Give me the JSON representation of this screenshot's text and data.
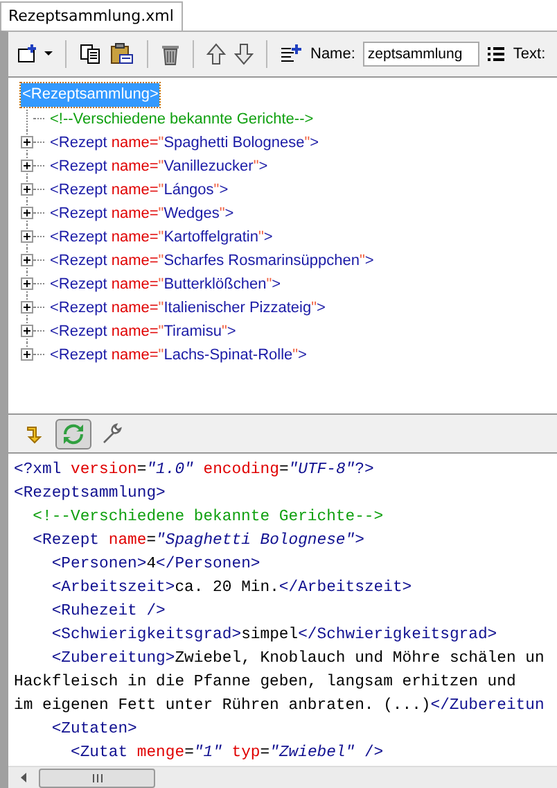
{
  "tab": {
    "label": "Rezeptsammlung.xml",
    "selected": true
  },
  "toolbar": {
    "name_label": "Name:",
    "name_value": "zeptsammlung",
    "text_label": "Text:"
  },
  "tree": {
    "root": {
      "label": "<Rezeptsammlung>",
      "selected": true,
      "children": [
        {
          "kind": "comment",
          "tokens": [
            {
              "kind": "comment",
              "text": "<!--Verschiedene bekannte Gerichte-->"
            }
          ]
        },
        {
          "kind": "element",
          "expanded": false,
          "tokens": [
            {
              "kind": "tag",
              "text": "<Rezept "
            },
            {
              "kind": "attr",
              "text": "name="
            },
            {
              "kind": "quote",
              "text": "\""
            },
            {
              "kind": "value",
              "text": "Spaghetti Bolognese"
            },
            {
              "kind": "quote",
              "text": "\""
            },
            {
              "kind": "tag",
              "text": ">"
            }
          ]
        },
        {
          "kind": "element",
          "expanded": false,
          "tokens": [
            {
              "kind": "tag",
              "text": "<Rezept "
            },
            {
              "kind": "attr",
              "text": "name="
            },
            {
              "kind": "quote",
              "text": "\""
            },
            {
              "kind": "value",
              "text": "Vanillezucker"
            },
            {
              "kind": "quote",
              "text": "\""
            },
            {
              "kind": "tag",
              "text": ">"
            }
          ]
        },
        {
          "kind": "element",
          "expanded": false,
          "tokens": [
            {
              "kind": "tag",
              "text": "<Rezept "
            },
            {
              "kind": "attr",
              "text": "name="
            },
            {
              "kind": "quote",
              "text": "\""
            },
            {
              "kind": "value",
              "text": "Lángos"
            },
            {
              "kind": "quote",
              "text": "\""
            },
            {
              "kind": "tag",
              "text": ">"
            }
          ]
        },
        {
          "kind": "element",
          "expanded": false,
          "tokens": [
            {
              "kind": "tag",
              "text": "<Rezept "
            },
            {
              "kind": "attr",
              "text": "name="
            },
            {
              "kind": "quote",
              "text": "\""
            },
            {
              "kind": "value",
              "text": "Wedges"
            },
            {
              "kind": "quote",
              "text": "\""
            },
            {
              "kind": "tag",
              "text": ">"
            }
          ]
        },
        {
          "kind": "element",
          "expanded": false,
          "tokens": [
            {
              "kind": "tag",
              "text": "<Rezept "
            },
            {
              "kind": "attr",
              "text": "name="
            },
            {
              "kind": "quote",
              "text": "\""
            },
            {
              "kind": "value",
              "text": "Kartoffelgratin"
            },
            {
              "kind": "quote",
              "text": "\""
            },
            {
              "kind": "tag",
              "text": ">"
            }
          ]
        },
        {
          "kind": "element",
          "expanded": false,
          "tokens": [
            {
              "kind": "tag",
              "text": "<Rezept "
            },
            {
              "kind": "attr",
              "text": "name="
            },
            {
              "kind": "quote",
              "text": "\""
            },
            {
              "kind": "value",
              "text": "Scharfes Rosmarinsüppchen"
            },
            {
              "kind": "quote",
              "text": "\""
            },
            {
              "kind": "tag",
              "text": ">"
            }
          ]
        },
        {
          "kind": "element",
          "expanded": false,
          "tokens": [
            {
              "kind": "tag",
              "text": "<Rezept "
            },
            {
              "kind": "attr",
              "text": "name="
            },
            {
              "kind": "quote",
              "text": "\""
            },
            {
              "kind": "value",
              "text": "Butterklößchen"
            },
            {
              "kind": "quote",
              "text": "\""
            },
            {
              "kind": "tag",
              "text": ">"
            }
          ]
        },
        {
          "kind": "element",
          "expanded": false,
          "tokens": [
            {
              "kind": "tag",
              "text": "<Rezept "
            },
            {
              "kind": "attr",
              "text": "name="
            },
            {
              "kind": "quote",
              "text": "\""
            },
            {
              "kind": "value",
              "text": "Italienischer Pizzateig"
            },
            {
              "kind": "quote",
              "text": "\""
            },
            {
              "kind": "tag",
              "text": ">"
            }
          ]
        },
        {
          "kind": "element",
          "expanded": false,
          "tokens": [
            {
              "kind": "tag",
              "text": "<Rezept "
            },
            {
              "kind": "attr",
              "text": "name="
            },
            {
              "kind": "quote",
              "text": "\""
            },
            {
              "kind": "value",
              "text": "Tiramisu"
            },
            {
              "kind": "quote",
              "text": "\""
            },
            {
              "kind": "tag",
              "text": ">"
            }
          ]
        },
        {
          "kind": "element",
          "expanded": false,
          "tokens": [
            {
              "kind": "tag",
              "text": "<Rezept "
            },
            {
              "kind": "attr",
              "text": "name="
            },
            {
              "kind": "quote",
              "text": "\""
            },
            {
              "kind": "value",
              "text": "Lachs-Spinat-Rolle"
            },
            {
              "kind": "quote",
              "text": "\""
            },
            {
              "kind": "tag",
              "text": ">"
            }
          ]
        }
      ]
    }
  },
  "view_buttons": [
    {
      "kind": "insert",
      "selected": false
    },
    {
      "kind": "sync",
      "selected": true
    },
    {
      "kind": "settings",
      "selected": false
    }
  ],
  "source": {
    "lines": [
      [
        {
          "kind": "tag",
          "text": "<?xml "
        },
        {
          "kind": "attr",
          "text": "version"
        },
        {
          "kind": "punct",
          "text": "="
        },
        {
          "kind": "value",
          "text": "\"1.0\""
        },
        {
          "kind": "attr",
          "text": " encoding"
        },
        {
          "kind": "punct",
          "text": "="
        },
        {
          "kind": "value",
          "text": "\"UTF-8\""
        },
        {
          "kind": "tag",
          "text": "?>"
        }
      ],
      [
        {
          "kind": "tag",
          "text": "<Rezeptsammlung>"
        }
      ],
      [
        {
          "kind": "comment",
          "text": "  <!--Verschiedene bekannte Gerichte-->"
        }
      ],
      [
        {
          "kind": "tag",
          "text": "  <Rezept "
        },
        {
          "kind": "attr",
          "text": "name"
        },
        {
          "kind": "punct",
          "text": "="
        },
        {
          "kind": "value",
          "text": "\"Spaghetti Bolognese\""
        },
        {
          "kind": "tag",
          "text": ">"
        }
      ],
      [
        {
          "kind": "tag",
          "text": "    <Personen>"
        },
        {
          "kind": "text",
          "text": "4"
        },
        {
          "kind": "tag",
          "text": "</Personen>"
        }
      ],
      [
        {
          "kind": "tag",
          "text": "    <Arbeitszeit>"
        },
        {
          "kind": "text",
          "text": "ca. 20 Min."
        },
        {
          "kind": "tag",
          "text": "</Arbeitszeit>"
        }
      ],
      [
        {
          "kind": "tag",
          "text": "    <Ruhezeit />"
        }
      ],
      [
        {
          "kind": "tag",
          "text": "    <Schwierigkeitsgrad>"
        },
        {
          "kind": "text",
          "text": "simpel"
        },
        {
          "kind": "tag",
          "text": "</Schwierigkeitsgrad>"
        }
      ],
      [
        {
          "kind": "tag",
          "text": "    <Zubereitung>"
        },
        {
          "kind": "text",
          "text": "Zwiebel, Knoblauch und Möhre schälen un"
        }
      ],
      [
        {
          "kind": "text",
          "text": "Hackfleisch in die Pfanne geben, langsam erhitzen und"
        }
      ],
      [
        {
          "kind": "text",
          "text": "im eigenen Fett unter Rühren anbraten. (...)"
        },
        {
          "kind": "tag",
          "text": "</Zubereitun"
        }
      ],
      [
        {
          "kind": "tag",
          "text": "    <Zutaten>"
        }
      ],
      [
        {
          "kind": "tag",
          "text": "      <Zutat "
        },
        {
          "kind": "attr",
          "text": "menge"
        },
        {
          "kind": "punct",
          "text": "="
        },
        {
          "kind": "value",
          "text": "\"1\""
        },
        {
          "kind": "attr",
          "text": " typ"
        },
        {
          "kind": "punct",
          "text": "="
        },
        {
          "kind": "value",
          "text": "\"Zwiebel\""
        },
        {
          "kind": "tag",
          "text": " />"
        }
      ]
    ]
  }
}
